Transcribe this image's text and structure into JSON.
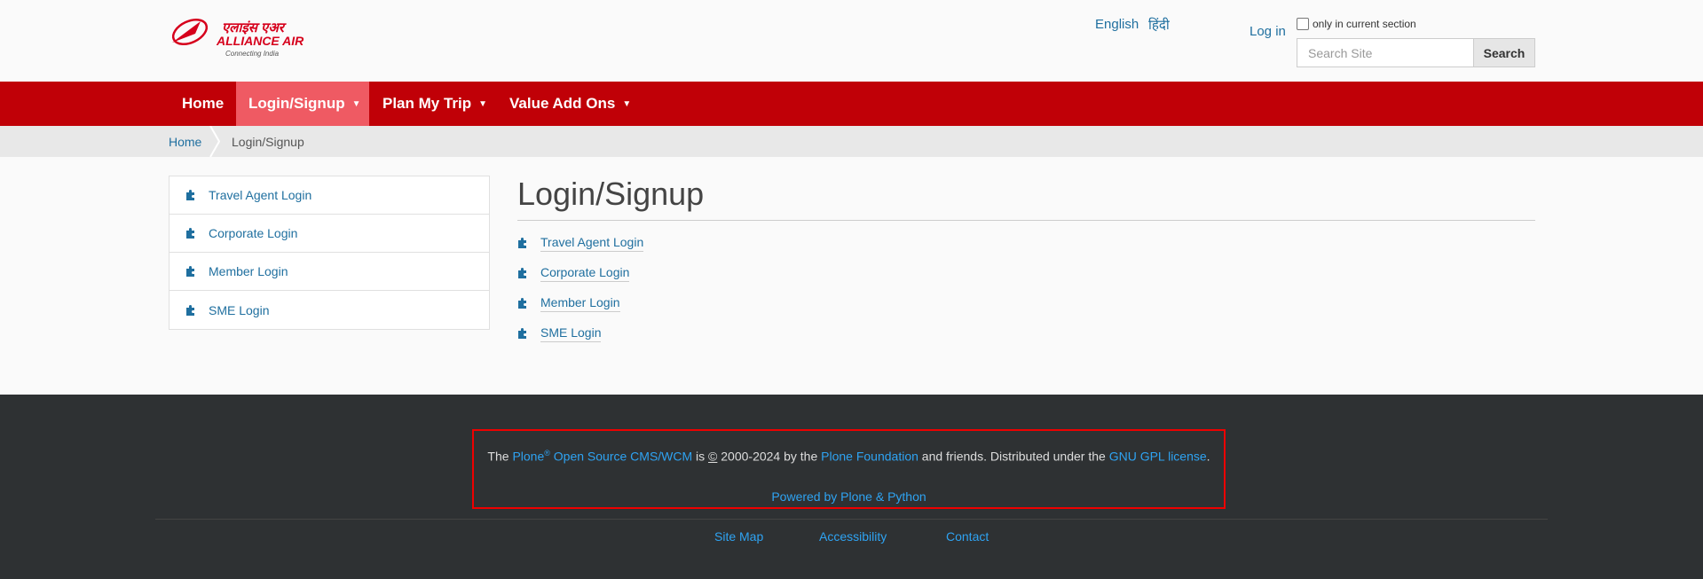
{
  "header": {
    "logo_main": "ALLIANCE AIR",
    "logo_hindi": "एलाइंस एअर",
    "logo_tagline": "Connecting India",
    "lang_english": "English",
    "lang_hindi": "हिंदी",
    "login": "Log in",
    "only_current": "only in current section",
    "search_placeholder": "Search Site",
    "search_button": "Search"
  },
  "nav": {
    "items": [
      {
        "label": "Home"
      },
      {
        "label": "Login/Signup"
      },
      {
        "label": "Plan My Trip"
      },
      {
        "label": "Value Add Ons"
      }
    ],
    "caret": "▼"
  },
  "breadcrumb": {
    "home": "Home",
    "current": "Login/Signup"
  },
  "sidebar": {
    "items": [
      {
        "label": "Travel Agent Login"
      },
      {
        "label": "Corporate Login"
      },
      {
        "label": "Member Login"
      },
      {
        "label": "SME Login"
      }
    ]
  },
  "content": {
    "title": "Login/Signup",
    "links": [
      {
        "label": "Travel Agent Login"
      },
      {
        "label": "Corporate Login"
      },
      {
        "label": "Member Login"
      },
      {
        "label": "SME Login"
      }
    ]
  },
  "footer": {
    "text_the": "The ",
    "plone": "Plone",
    "reg": "®",
    "cms": "Open Source CMS/WCM",
    "text_is": " is ",
    "copyright": "©",
    "text_years": " 2000-2024 by the ",
    "foundation": "Plone Foundation",
    "text_friends": " and friends. Distributed under the ",
    "license": "GNU GPL license",
    "text_end": ".",
    "powered": "Powered by Plone & Python",
    "links": [
      {
        "label": "Site Map"
      },
      {
        "label": "Accessibility"
      },
      {
        "label": "Contact"
      }
    ]
  },
  "colors": {
    "nav_bg": "#c00007",
    "nav_active": "#ef5a63",
    "link": "#1f6f9f",
    "footer_bg": "#2e3133",
    "footer_link": "#2ea3f2",
    "highlight_border": "#ee0000"
  },
  "icons": {
    "content_link_icon": "puzzle-piece-icon",
    "nav_caret_icon": "caret-down-icon"
  }
}
